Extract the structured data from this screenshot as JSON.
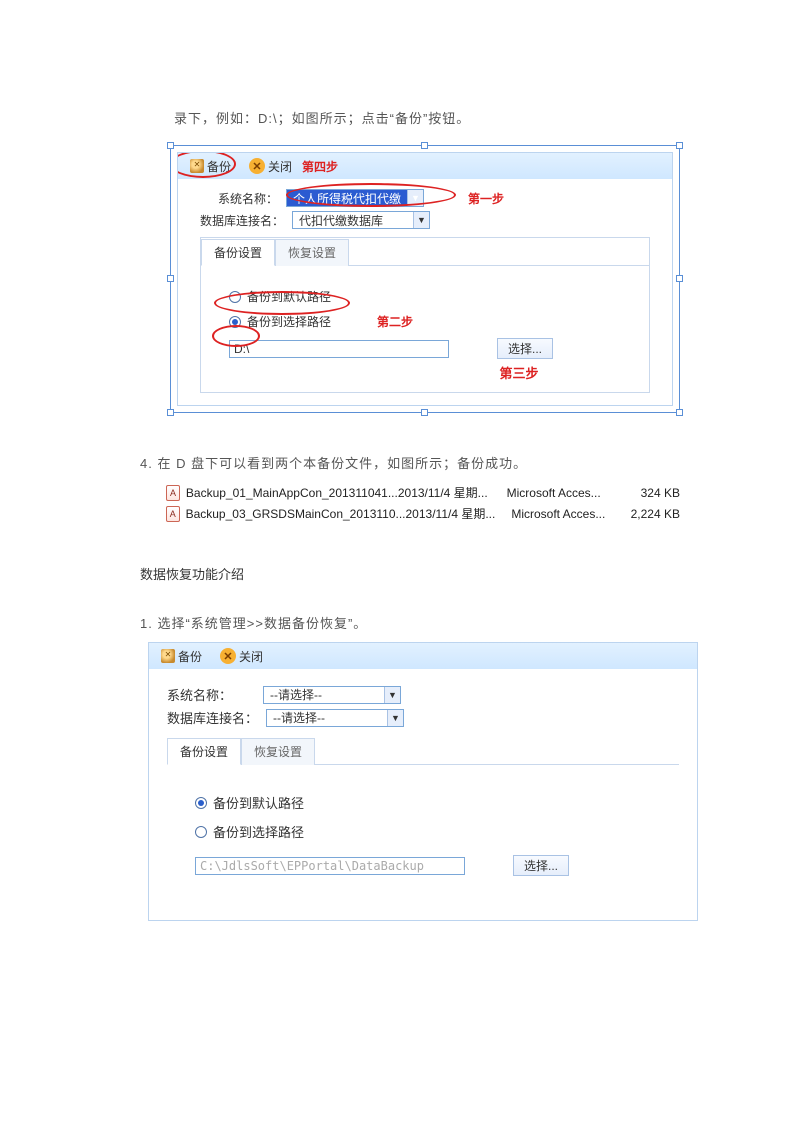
{
  "intro_text": "录下，例如：D:\\；如图所示；点击“备份”按钮。",
  "fig1": {
    "toolbar": {
      "backup": "备份",
      "close": "关闭"
    },
    "step4": "第四步",
    "step1": "第一步",
    "step2": "第二步",
    "step3": "第三步",
    "label_system": "系统名称：",
    "system_value": "个人所得税代扣代缴",
    "label_dbconn": "数据库连接名：",
    "dbconn_value": "代扣代缴数据库",
    "tab_backup": "备份设置",
    "tab_restore": "恢复设置",
    "radio_default": "备份到默认路径",
    "radio_select": "备份到选择路径",
    "path_value": "D:\\",
    "btn_select": "选择..."
  },
  "step4_text": "4. 在 D 盘下可以看到两个本备份文件，如图所示；备份成功。",
  "files": [
    {
      "name": "Backup_01_MainAppCon_201311041...",
      "date": "2013/11/4 星期...",
      "type": "Microsoft Acces...",
      "size": "324 KB"
    },
    {
      "name": "Backup_03_GRSDSMainCon_2013110...",
      "date": "2013/11/4 星期...",
      "type": "Microsoft Acces...",
      "size": "2,224 KB"
    }
  ],
  "heading_restore": "数据恢复功能介绍",
  "restore_step1": "1. 选择“系统管理>>数据备份恢复”。",
  "fig2": {
    "toolbar": {
      "backup": "备份",
      "close": "关闭"
    },
    "label_system": "系统名称：",
    "system_value": "--请选择--",
    "label_dbconn": "数据库连接名：",
    "dbconn_value": "--请选择--",
    "tab_backup": "备份设置",
    "tab_restore": "恢复设置",
    "radio_default": "备份到默认路径",
    "radio_select": "备份到选择路径",
    "path_value": "C:\\JdlsSoft\\EPPortal\\DataBackup",
    "btn_select": "选择..."
  }
}
